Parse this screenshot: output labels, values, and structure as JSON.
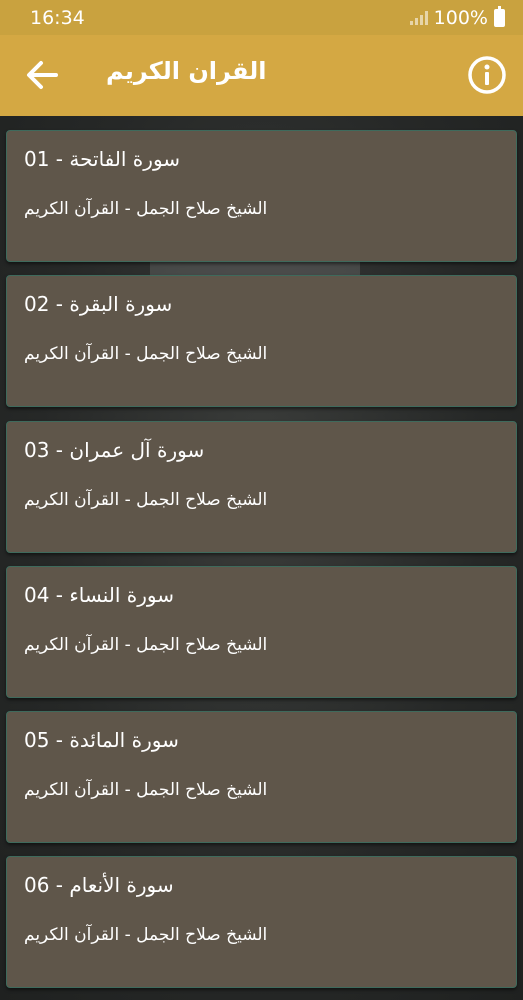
{
  "status_bar": {
    "time": "16:34",
    "battery": "100%"
  },
  "app_bar": {
    "title": "القران الكريم"
  },
  "colors": {
    "accent": "#d4a843",
    "card_bg": "#5f564a",
    "card_border": "#3e6a5c"
  },
  "icons": {
    "back": "arrow-left-icon",
    "info": "info-icon"
  },
  "surahs": [
    {
      "title": "01 - سورة الفاتحة",
      "subtitle": "الشيخ صلاح الجمل - القرآن الكريم"
    },
    {
      "title": "02 - سورة البقرة",
      "subtitle": "الشيخ صلاح الجمل - القرآن الكريم"
    },
    {
      "title": "03 - سورة آل عمران",
      "subtitle": "الشيخ صلاح الجمل - القرآن الكريم"
    },
    {
      "title": "04 - سورة النساء",
      "subtitle": "الشيخ صلاح الجمل - القرآن الكريم"
    },
    {
      "title": "05 - سورة المائدة",
      "subtitle": "الشيخ صلاح الجمل - القرآن الكريم"
    },
    {
      "title": "06 - سورة الأنعام",
      "subtitle": "الشيخ صلاح الجمل - القرآن الكريم"
    }
  ]
}
